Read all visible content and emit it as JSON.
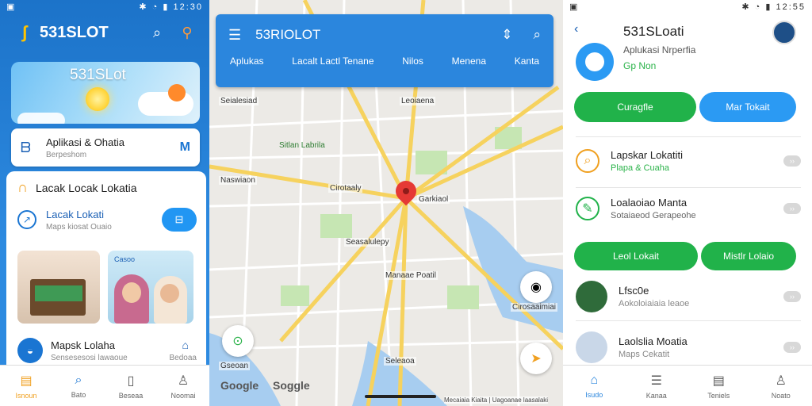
{
  "left": {
    "status_time": "12:30",
    "brand": "531SLOT",
    "weather_title": "531SLot",
    "app_card": {
      "title": "Aplikasi & Ohatia",
      "subtitle": "Berpeshom",
      "right_icon": "M"
    },
    "sheet_title": "Lacak Locak Lokatia",
    "track": {
      "title": "Lacak Lokati",
      "subtitle": "Maps kiosat Ouaio"
    },
    "image_caption": "Casoo",
    "maps_row": {
      "title": "Mapsk Lolaha",
      "subtitle": "Sensesesosi lawaoue",
      "extra": "Bedoaa"
    },
    "nav": [
      {
        "label": "Isnoun",
        "icon": "home-icon"
      },
      {
        "label": "Bato",
        "icon": "search-icon"
      },
      {
        "label": "Beseaa",
        "icon": "map-icon"
      },
      {
        "label": "Noomai",
        "icon": "person-icon"
      }
    ],
    "colors": {
      "primary": "#2b86dd",
      "accent": "#f0a020"
    }
  },
  "middle": {
    "title": "53RIOLOT",
    "tabs": [
      "Aplukas",
      "Lacalt Lactl Tenane",
      "Nilos",
      "Menena",
      "Kanta"
    ],
    "map_labels": {
      "a": "Seialesiad",
      "b": "Leoiaena",
      "c": "Sitlan Labrila",
      "d": "Naswiaon",
      "e": "Cirotaaly",
      "f": "Garkiaol",
      "g": "Manaae Poatil",
      "h": "Cirosaaimiai",
      "i": "Seasalulepy",
      "j": "Gseoan",
      "k": "Seleaoa"
    },
    "google_1": "Google",
    "google_2": "Soggle",
    "attribution": "Mecaiaia Kiaita | Uagoanae laasalaki"
  },
  "right": {
    "status_time": "12:55",
    "title": "531SLoati",
    "subtitle": "Aplukasi Nrperfia",
    "status": "Gp Non",
    "btn1": "Curagfle",
    "btn2": "Mar Tokait",
    "list": [
      {
        "title": "Lapskar Lokatiti",
        "subtitle": "Plapa & Cuaha",
        "icon": "search-icon"
      },
      {
        "title": "Loalaoiao Manta",
        "subtitle": "Sotaiaeod Gerapeohe",
        "icon": "leaf-icon"
      }
    ],
    "btn3": "Leol Lokait",
    "btn4": "Mistlr Lolaio",
    "contacts": [
      {
        "title": "Lfsc0e",
        "subtitle": "Aokoloiaiaia leaoe"
      },
      {
        "title": "Laolslia Moatia",
        "subtitle": "Maps Cekatit"
      }
    ],
    "nav": [
      {
        "label": "Isudo",
        "icon": "home-icon"
      },
      {
        "label": "Kanaa",
        "icon": "layers-icon"
      },
      {
        "label": "Teniels",
        "icon": "list-icon"
      },
      {
        "label": "Noato",
        "icon": "person-icon"
      }
    ]
  }
}
